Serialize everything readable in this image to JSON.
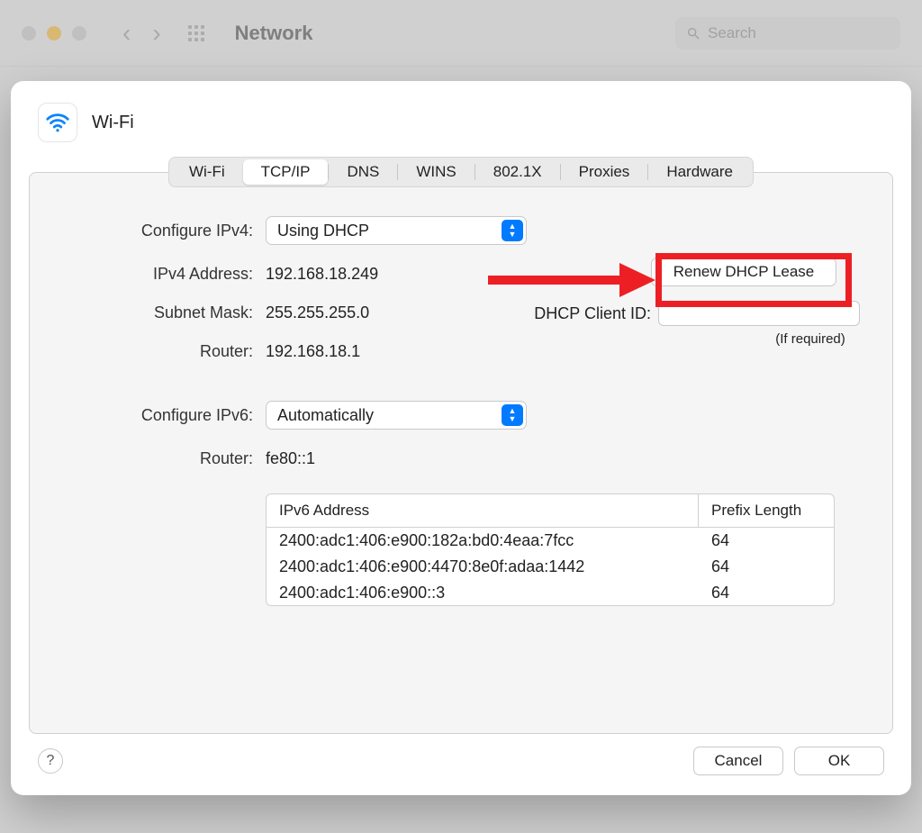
{
  "chrome": {
    "title": "Network",
    "search_placeholder": "Search"
  },
  "sheet": {
    "title": "Wi-Fi",
    "tabs": [
      "Wi-Fi",
      "TCP/IP",
      "DNS",
      "WINS",
      "802.1X",
      "Proxies",
      "Hardware"
    ],
    "active_tab": "TCP/IP"
  },
  "ipv4": {
    "configure_label": "Configure IPv4:",
    "configure_value": "Using DHCP",
    "address_label": "IPv4 Address:",
    "address_value": "192.168.18.249",
    "subnet_label": "Subnet Mask:",
    "subnet_value": "255.255.255.0",
    "router_label": "Router:",
    "router_value": "192.168.18.1",
    "renew_label": "Renew DHCP Lease",
    "client_id_label": "DHCP Client ID:",
    "if_required": "(If required)"
  },
  "ipv6": {
    "configure_label": "Configure IPv6:",
    "configure_value": "Automatically",
    "router_label": "Router:",
    "router_value": "fe80::1",
    "col_address": "IPv6 Address",
    "col_prefix": "Prefix Length",
    "rows": [
      {
        "addr": "2400:adc1:406:e900:182a:bd0:4eaa:7fcc",
        "prefix": "64"
      },
      {
        "addr": "2400:adc1:406:e900:4470:8e0f:adaa:1442",
        "prefix": "64"
      },
      {
        "addr": "2400:adc1:406:e900::3",
        "prefix": "64"
      }
    ]
  },
  "footer": {
    "help": "?",
    "cancel": "Cancel",
    "ok": "OK"
  }
}
